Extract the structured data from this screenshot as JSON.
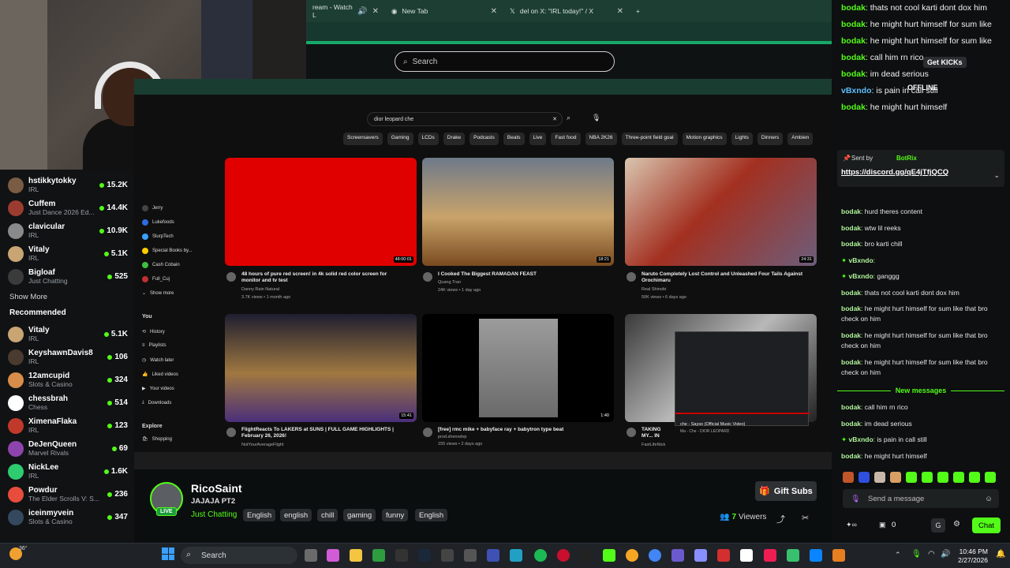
{
  "browser": {
    "tabs": [
      {
        "label": "ream - Watch L"
      },
      {
        "label": "New Tab"
      },
      {
        "label": "del on X: \"IRL today!\" / X"
      }
    ],
    "search_placeholder": "Search"
  },
  "inner_youtube": {
    "search_query": "dior leopard che",
    "chips": [
      "Screensavers",
      "Gaming",
      "LCDs",
      "Drake",
      "Podcasts",
      "Beats",
      "Live",
      "Fast food",
      "NBA 2K26",
      "Three-point field goal",
      "Motion graphics",
      "Lights",
      "Dinners",
      "Ambien"
    ],
    "side_items": [
      "Jerry",
      "Lukefoods",
      "SlurpTech",
      "Special Books by...",
      "Cash Cobain",
      "Full_Cuj",
      "Show more"
    ],
    "you_items": [
      "You",
      "History",
      "Playlists",
      "Watch later",
      "Liked videos",
      "Your videos",
      "Downloads"
    ],
    "explore_items": [
      "Explore",
      "Shopping"
    ],
    "videos": [
      {
        "title": "48 hours of pure red screen! in 4k solid red color screen for monitor and tv test",
        "channel": "Danny Rain Natural",
        "meta": "3.7K views • 1 month ago",
        "duration": "48:00:01"
      },
      {
        "title": "I Cooked The Biggest RAMADAN FEAST",
        "channel": "Quang Tran",
        "meta": "24K views • 1 day ago",
        "duration": "18:21"
      },
      {
        "title": "Naruto Completely Lost Control and Unleashed Four Tails Against Orochimaru",
        "channel": "Real Shinobi",
        "meta": "50K views • 6 days ago",
        "duration": "24:31"
      },
      {
        "title": "FlightReacts To LAKERS at SUNS | FULL GAME HIGHLIGHTS | February 26, 2026!",
        "channel": "NotYourAverageFlight",
        "meta": "",
        "duration": "15:41"
      },
      {
        "title": "[free] rmc mike + babyface ray + babytron type beat",
        "channel": "prod.shenndvp",
        "meta": "155 views • 2 days ago",
        "duration": "1:40"
      },
      {
        "title": "TAKING MY... IN NORTH C...",
        "channel": "FastLifeNick",
        "meta": "",
        "duration": ""
      }
    ],
    "mini_player": {
      "title": "che - Sayso (Official Music Video)",
      "channel": "Ma - Che - DIOR LEOPARD"
    }
  },
  "sidebar": {
    "following": [
      {
        "name": "hstikkytokky",
        "category": "IRL",
        "viewers": "15.2K",
        "color": "#7a5c44"
      },
      {
        "name": "Cuffem",
        "category": "Just Dance 2026 Ed...",
        "viewers": "14.4K",
        "color": "#9c3b2f"
      },
      {
        "name": "clavicular",
        "category": "IRL",
        "viewers": "10.9K",
        "color": "#8a8a8a"
      },
      {
        "name": "Vitaly",
        "category": "IRL",
        "viewers": "5.1K",
        "color": "#c9a574"
      },
      {
        "name": "Bigloaf",
        "category": "Just Chatting",
        "viewers": "525",
        "color": "#3b3b3b"
      }
    ],
    "show_more": "Show More",
    "recommended_title": "Recommended",
    "recommended": [
      {
        "name": "Vitaly",
        "category": "IRL",
        "viewers": "5.1K",
        "color": "#c9a574"
      },
      {
        "name": "KeyshawnDavis8",
        "category": "IRL",
        "viewers": "106",
        "color": "#4a3b30"
      },
      {
        "name": "12amcupid",
        "category": "Slots & Casino",
        "viewers": "324",
        "color": "#d88d4a"
      },
      {
        "name": "chessbrah",
        "category": "Chess",
        "viewers": "514",
        "color": "#ffffff"
      },
      {
        "name": "XimenaFlaka",
        "category": "IRL",
        "viewers": "123",
        "color": "#c0392b"
      },
      {
        "name": "DeJenQueen",
        "category": "Marvel Rivals",
        "viewers": "69",
        "color": "#8e44ad"
      },
      {
        "name": "NickLee",
        "category": "IRL",
        "viewers": "1.6K",
        "color": "#2ecc71"
      },
      {
        "name": "Powdur",
        "category": "The Elder Scrolls V: S...",
        "viewers": "236",
        "color": "#e74c3c"
      },
      {
        "name": "iceinmyvein",
        "category": "Slots & Casino",
        "viewers": "347",
        "color": "#34495e"
      }
    ]
  },
  "channel": {
    "name": "RicoSaint",
    "live_label": "LIVE",
    "title": "JAJAJA PT2",
    "category": "Just Chatting",
    "tags": [
      "English",
      "english",
      "chill",
      "gaming",
      "funny",
      "English"
    ],
    "gift_subs": "Gift Subs",
    "viewer_count": "7",
    "viewers_label": "Viewers"
  },
  "chat": {
    "overlay_messages": [
      {
        "user": "bodak",
        "text": "thats not cool karti dont dox him"
      },
      {
        "user": "bodak",
        "text": "he might hurt himself for sum like"
      },
      {
        "user": "bodak",
        "text": "he might hurt himself for sum like"
      },
      {
        "user": "bodak",
        "text": "call him rn rico"
      },
      {
        "user": "bodak",
        "text": "im dead serious"
      },
      {
        "user": "vBxndo",
        "text": "is pain in call still"
      },
      {
        "user": "bodak",
        "text": "he might hurt himself"
      }
    ],
    "offline_label": "OFFLINE",
    "get_kicks": "Get KICKs",
    "pinned_sender_label": "Sent by",
    "pinned_sender": "BotRix",
    "pinned_link": "https://discord.gg/qE4jTfjQCQ",
    "messages": [
      {
        "user": "bodak",
        "text": "hurd theres content"
      },
      {
        "user": "bodak",
        "text": "wtw lil reeks"
      },
      {
        "user": "bodak",
        "text": "bro karti chill"
      },
      {
        "user": "vBxndo",
        "text": ""
      },
      {
        "user": "vBxndo",
        "text": "ganggg"
      },
      {
        "user": "bodak",
        "text": "thats not cool karti dont dox him"
      },
      {
        "user": "bodak",
        "text": "he might hurt himself for sum like that bro check on him"
      },
      {
        "user": "bodak",
        "text": "he might hurt himself for sum like that bro check on him"
      },
      {
        "user": "bodak",
        "text": "he might hurt himself for sum like that bro check on him"
      }
    ],
    "new_messages_label": "New messages",
    "new_messages": [
      {
        "user": "bodak",
        "text": "call him rn rico"
      },
      {
        "user": "bodak",
        "text": "im dead serious"
      },
      {
        "user": "vBxndo",
        "text": "is pain in call still"
      },
      {
        "user": "bodak",
        "text": "he might hurt himself"
      }
    ],
    "send_placeholder": "Send a message",
    "points": "0",
    "chat_button": "Chat",
    "user_initial": "G"
  },
  "taskbar": {
    "search_placeholder": "Search",
    "time": "10:46 PM",
    "date": "2/27/2026",
    "weather_temp": "36°"
  }
}
